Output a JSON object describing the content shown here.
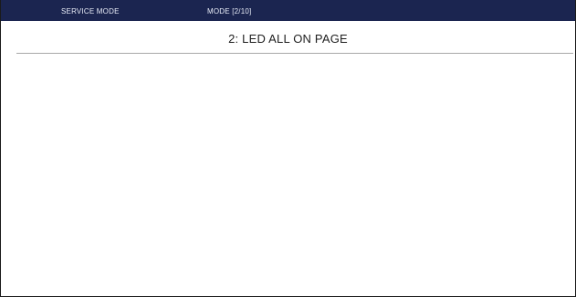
{
  "header": {
    "service_label": "SERVICE MODE",
    "mode_label": "MODE [2/10]"
  },
  "page": {
    "title": "2: LED ALL ON PAGE"
  },
  "colors": {
    "header_bg": "#1b2550",
    "header_text": "#e8ecf7",
    "background": "#ffffff",
    "divider": "#a8a8a8"
  }
}
